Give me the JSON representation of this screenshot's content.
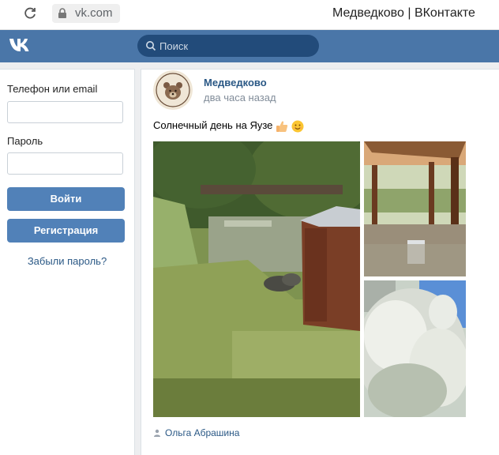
{
  "browser": {
    "url": "vk.com",
    "tab_title": "Медведково | ВКонтакте"
  },
  "header": {
    "logo": "VK",
    "search_placeholder": "Поиск",
    "brand_color": "#4a76a8"
  },
  "login": {
    "phone_label": "Телефон или email",
    "phone_value": "",
    "password_label": "Пароль",
    "password_value": "",
    "login_button": "Войти",
    "register_button": "Регистрация",
    "forgot_link": "Забыли пароль?"
  },
  "post": {
    "author": "Медведково",
    "time": "два часа назад",
    "text": "Солнечный день на Яузе",
    "emojis": [
      "thumbs-up",
      "smiling-face"
    ],
    "photos": [
      {
        "name": "park-pond-ducks-photo"
      },
      {
        "name": "wooden-enclosure-photo"
      },
      {
        "name": "blossoming-tree-photo"
      }
    ],
    "signer": "Ольга Абрашина"
  }
}
